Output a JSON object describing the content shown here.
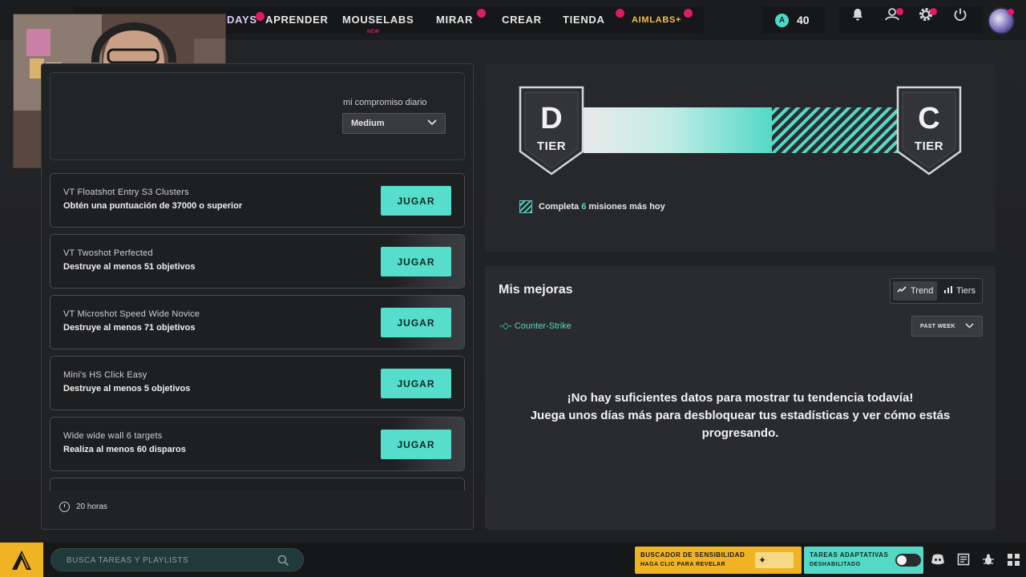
{
  "nav": {
    "items": [
      {
        "label": "DAYS"
      },
      {
        "label": "APRENDER"
      },
      {
        "label": "MOUSELABS",
        "badge": "NEW"
      },
      {
        "label": "MIRAR"
      },
      {
        "label": "CREAR"
      },
      {
        "label": "TIENDA"
      },
      {
        "label": "AIMLABS+"
      }
    ],
    "credits": "40",
    "icons": [
      "bell-icon",
      "friends-icon",
      "gear-icon",
      "power-icon"
    ]
  },
  "commitment": {
    "label": "mi compromiso diario",
    "value": "Medium"
  },
  "tasks": [
    {
      "title": "VT Floatshot Entry S3 Clusters",
      "desc": "Obtén una puntuación de 37000 o superior",
      "button": "JUGAR"
    },
    {
      "title": "VT Twoshot Perfected",
      "desc": "Destruye al menos 51 objetivos",
      "button": "JUGAR"
    },
    {
      "title": "VT Microshot Speed Wide Novice",
      "desc": "Destruye al menos 71 objetivos",
      "button": "JUGAR"
    },
    {
      "title": "Mini's HS Click Easy",
      "desc": "Destruye al menos 5 objetivos",
      "button": "JUGAR"
    },
    {
      "title": "Wide wide wall 6 targets",
      "desc": "Realiza al menos 60 disparos",
      "button": "JUGAR"
    }
  ],
  "time_left": "20 horas",
  "tier": {
    "current_letter": "D",
    "current_label": "TIER",
    "next_letter": "C",
    "next_label": "TIER",
    "progress": 0.6,
    "missions_prefix": "Completa",
    "missions_count": "6",
    "missions_suffix": "misiones más hoy",
    "colors": {
      "accent": "#54d9c7"
    }
  },
  "improvements": {
    "title": "Mis mejoras",
    "toggle_trend": "Trend",
    "toggle_tiers": "Tiers",
    "game": "-◇- Counter-Strike",
    "period": "PAST WEEK",
    "no_data_line1": "¡No hay suficientes datos para mostrar tu tendencia todavía!",
    "no_data_line2": "Juega unos días más para desbloquear tus estadísticas y ver cómo estás progresando."
  },
  "bottom": {
    "search_placeholder": "BUSCA TAREAS Y PLAYLISTS",
    "sensitivity_line1": "BUSCADOR DE SENSIBILIDAD",
    "sensitivity_line2": "HAGA CLIC PARA REVELAR",
    "adaptive_line1": "TAREAS ADAPTATIVAS",
    "adaptive_line2": "DESHABILITADO",
    "icons": [
      "discord-icon",
      "notes-icon",
      "bug-icon",
      "grid-icon"
    ],
    "colors": {
      "sensitivity": "#f0b323",
      "adaptive": "#54d9c7"
    }
  }
}
